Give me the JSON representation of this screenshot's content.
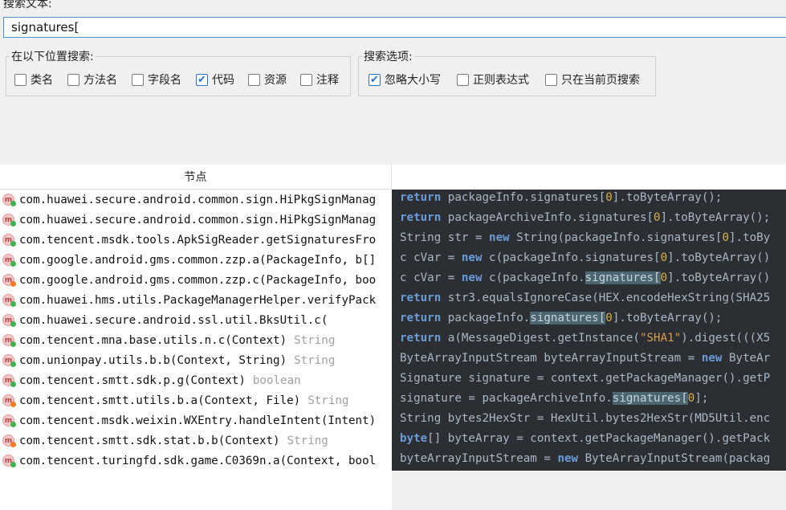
{
  "search": {
    "label": "搜索文本:",
    "value": "signatures["
  },
  "location_group": {
    "legend": "在以下位置搜索:",
    "options": [
      {
        "label": "类名",
        "checked": false
      },
      {
        "label": "方法名",
        "checked": false
      },
      {
        "label": "字段名",
        "checked": false
      },
      {
        "label": "代码",
        "checked": true
      },
      {
        "label": "资源",
        "checked": false
      },
      {
        "label": "注释",
        "checked": false
      }
    ]
  },
  "options_group": {
    "legend": "搜索选项:",
    "options": [
      {
        "label": "忽略大小写",
        "checked": true
      },
      {
        "label": "正则表达式",
        "checked": false
      },
      {
        "label": "只在当前页搜索",
        "checked": false
      }
    ]
  },
  "results": {
    "column_header": "节点",
    "rows": [
      {
        "node": "com.huawei.secure.android.common.sign.HiPkgSignManag",
        "ret": "",
        "badge": "green"
      },
      {
        "node": "com.huawei.secure.android.common.sign.HiPkgSignManag",
        "ret": "",
        "badge": "green"
      },
      {
        "node": "com.tencent.msdk.tools.ApkSigReader.getSignaturesFro",
        "ret": "",
        "badge": "green"
      },
      {
        "node": "com.google.android.gms.common.zzp.a(PackageInfo, b[]",
        "ret": "",
        "badge": "green"
      },
      {
        "node": "com.google.android.gms.common.zzp.c(PackageInfo, boo",
        "ret": "",
        "badge": "orange"
      },
      {
        "node": "com.huawei.hms.utils.PackageManagerHelper.verifyPack",
        "ret": "",
        "badge": "green"
      },
      {
        "node": "com.huawei.secure.android.ssl.util.BksUtil.c(",
        "ret": "",
        "badge": "green"
      },
      {
        "node": "com.tencent.mna.base.utils.n.c(Context)",
        "ret": "String",
        "badge": "green"
      },
      {
        "node": "com.unionpay.utils.b.b(Context, String)",
        "ret": "String",
        "badge": "green"
      },
      {
        "node": "com.tencent.smtt.sdk.p.g(Context)",
        "ret": "boolean",
        "badge": "green"
      },
      {
        "node": "com.tencent.smtt.utils.b.a(Context, File)",
        "ret": "String",
        "badge": "orange"
      },
      {
        "node": "com.tencent.msdk.weixin.WXEntry.handleIntent(Intent)",
        "ret": "",
        "badge": "green"
      },
      {
        "node": "com.tencent.smtt.sdk.stat.b.b(Context)",
        "ret": "String",
        "badge": "orange"
      },
      {
        "node": "com.tencent.turingfd.sdk.game.C0369n.a(Context, bool",
        "ret": "",
        "badge": "green"
      }
    ]
  },
  "code_lines": [
    [
      [
        "kw",
        "return"
      ],
      [
        "t",
        " packageInfo.signatures["
      ],
      [
        "num",
        "0"
      ],
      [
        "t",
        "].toByteArray();"
      ]
    ],
    [
      [
        "kw",
        "return"
      ],
      [
        "t",
        " packageArchiveInfo.signatures["
      ],
      [
        "num",
        "0"
      ],
      [
        "t",
        "].toByteArray();"
      ]
    ],
    [
      [
        "t",
        "String str = "
      ],
      [
        "kw",
        "new"
      ],
      [
        "t",
        " String(packageInfo.signatures["
      ],
      [
        "num",
        "0"
      ],
      [
        "t",
        "].toBy"
      ]
    ],
    [
      [
        "t",
        "c cVar = "
      ],
      [
        "kw",
        "new"
      ],
      [
        "t",
        " c(packageInfo.signatures["
      ],
      [
        "num",
        "0"
      ],
      [
        "t",
        "].toByteArray()"
      ]
    ],
    [
      [
        "t",
        "c cVar = "
      ],
      [
        "kw",
        "new"
      ],
      [
        "t",
        " c(packageInfo."
      ],
      [
        "hl",
        "signatures["
      ],
      [
        "num",
        "0"
      ],
      [
        "t",
        "].toByteArray()"
      ]
    ],
    [
      [
        "kw",
        "return"
      ],
      [
        "t",
        " str3.equalsIgnoreCase(HEX.encodeHexString(SHA25"
      ]
    ],
    [
      [
        "kw",
        "return"
      ],
      [
        "t",
        " packageInfo."
      ],
      [
        "hl",
        "signatures["
      ],
      [
        "num",
        "0"
      ],
      [
        "t",
        "].toByteArray();"
      ]
    ],
    [
      [
        "kw",
        "return"
      ],
      [
        "t",
        " a(MessageDigest.getInstance("
      ],
      [
        "str",
        "\"SHA1\""
      ],
      [
        "t",
        ").digest(((X5"
      ]
    ],
    [
      [
        "t",
        "ByteArrayInputStream byteArrayInputStream = "
      ],
      [
        "kw",
        "new"
      ],
      [
        "t",
        " ByteAr"
      ]
    ],
    [
      [
        "t",
        "Signature signature = context.getPackageManager().getP"
      ]
    ],
    [
      [
        "t",
        "signature = packageArchiveInfo."
      ],
      [
        "hl",
        "signatures["
      ],
      [
        "num",
        "0"
      ],
      [
        "t",
        "];"
      ]
    ],
    [
      [
        "t",
        "String bytes2HexStr = HexUtil.bytes2HexStr(MD5Util.enc"
      ]
    ],
    [
      [
        "kw",
        "byte"
      ],
      [
        "t",
        "[] byteArray = context.getPackageManager().getPack"
      ]
    ],
    [
      [
        "t",
        "byteArrayInputStream = "
      ],
      [
        "kw",
        "new"
      ],
      [
        "t",
        " ByteArrayInputStream(packag"
      ]
    ]
  ]
}
